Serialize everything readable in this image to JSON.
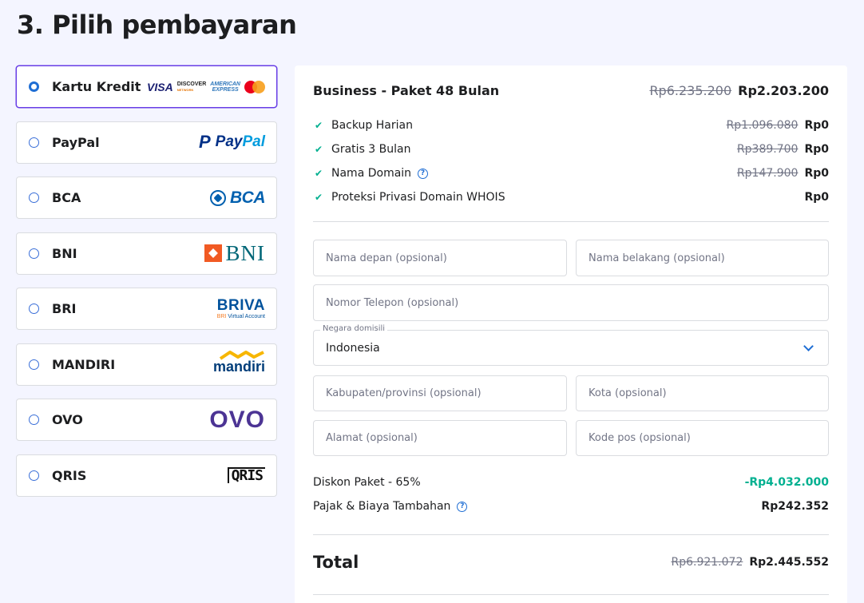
{
  "page_title": "3. Pilih pembayaran",
  "methods": [
    {
      "label": "Kartu Kredit",
      "selected": true
    },
    {
      "label": "PayPal"
    },
    {
      "label": "BCA"
    },
    {
      "label": "BNI"
    },
    {
      "label": "BRI"
    },
    {
      "label": "MANDIRI"
    },
    {
      "label": "OVO"
    },
    {
      "label": "QRIS"
    }
  ],
  "logos": {
    "visa": "VISA",
    "discover": "DISCOVER",
    "discover_sub": "NETWORK",
    "amex_1": "AMERICAN",
    "amex_2": "EXPRESS",
    "paypal_mark": "P",
    "paypal_1": "Pay",
    "paypal_2": "Pal",
    "bca": "BCA",
    "bni": "BNI",
    "briva": "BRIVA",
    "briva_sub_1": "BRI",
    "briva_sub_2": " Virtual Account",
    "mandiri": "mandiri",
    "ovo": "OVO",
    "qris": "QRIS"
  },
  "order": {
    "plan_name": "Business - Paket 48 Bulan",
    "plan_old_price": "Rp6.235.200",
    "plan_price": "Rp2.203.200",
    "features": [
      {
        "label": "Backup Harian",
        "old": "Rp1.096.080",
        "price": "Rp0"
      },
      {
        "label": "Gratis 3 Bulan",
        "old": "Rp389.700",
        "price": "Rp0"
      },
      {
        "label": "Nama Domain",
        "old": "Rp147.900",
        "price": "Rp0",
        "help": "?"
      },
      {
        "label": "Proteksi Privasi Domain WHOIS",
        "old": "",
        "price": "Rp0"
      }
    ],
    "check_glyph": "✔"
  },
  "form": {
    "first_name": "Nama depan (opsional)",
    "last_name": "Nama belakang (opsional)",
    "phone": "Nomor Telepon (opsional)",
    "country_label": "Negara domisili",
    "country_value": "Indonesia",
    "province": "Kabupaten/provinsi (opsional)",
    "city": "Kota (opsional)",
    "address": "Alamat (opsional)",
    "postal": "Kode pos (opsional)"
  },
  "summary": {
    "discount_label": "Diskon Paket - 65%",
    "discount_value": "-Rp4.032.000",
    "tax_label": "Pajak & Biaya Tambahan",
    "tax_help": "?",
    "tax_value": "Rp242.352",
    "total_label": "Total",
    "total_old": "Rp6.921.072",
    "total_value": "Rp2.445.552"
  },
  "colors": {
    "accent": "#673de6",
    "link_blue": "#1f6ed4",
    "success": "#00b090",
    "background": "#f4f5ff"
  }
}
